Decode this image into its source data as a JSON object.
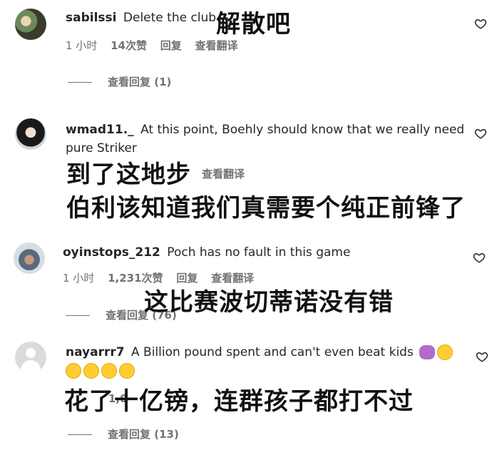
{
  "comments": [
    {
      "username": "sabilssi",
      "text": "Delete the club",
      "time": "1 小时",
      "likes": "14次赞",
      "reply": "回复",
      "translate": "查看翻译",
      "view_replies": "查看回复 (1)",
      "overlay": "解散吧"
    },
    {
      "username": "wmad11._",
      "text_line1": "At this point, Boehly should know that we really need",
      "text_line2": "pure Striker",
      "translate": "查看翻译",
      "overlay_line1": "到了这地步",
      "overlay_line2": "伯利该知道我们真需要个纯正前锋了"
    },
    {
      "username": "oyinstops_212",
      "text": "Poch has no fault in this game",
      "time": "1 小时",
      "likes": "1,231次赞",
      "reply": "回复",
      "translate": "查看翻译",
      "view_replies": "查看回复 (76)",
      "overlay": "这比赛波切蒂诺没有错"
    },
    {
      "username": "nayarrr7",
      "text": "A Billion pound spent and can't even beat kids",
      "likes_partial": "1,0",
      "view_replies": "查看回复 (13)",
      "overlay": "花了十亿镑，连群孩子都打不过"
    }
  ],
  "icons": {
    "heart": "heart-outline-icon",
    "emoji_laugh": "rolling-laughing-emoji",
    "emoji_shrug": "person-shrugging-emoji"
  }
}
